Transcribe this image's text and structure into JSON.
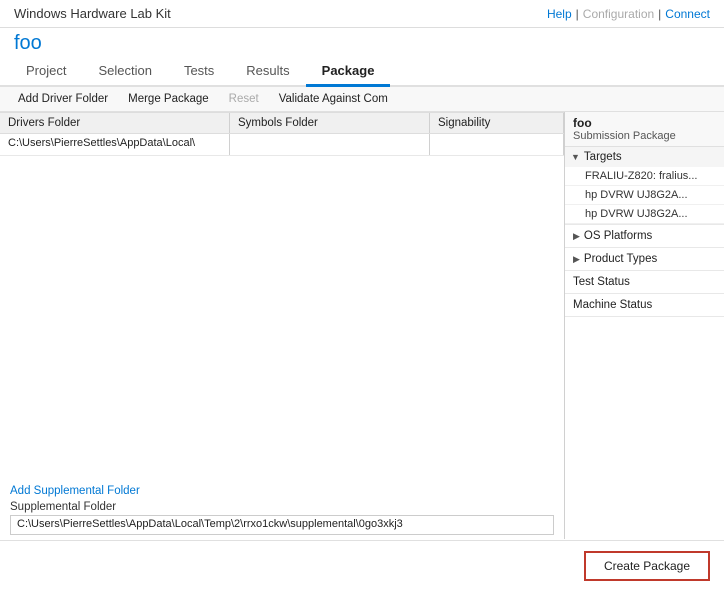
{
  "header": {
    "title": "Windows Hardware Lab Kit",
    "links": {
      "help": "Help",
      "sep1": "|",
      "config": "Configuration",
      "sep2": "|",
      "connect": "Connect"
    }
  },
  "app_name": "foo",
  "nav": {
    "tabs": [
      {
        "id": "project",
        "label": "Project",
        "active": false
      },
      {
        "id": "selection",
        "label": "Selection",
        "active": false
      },
      {
        "id": "tests",
        "label": "Tests",
        "active": false
      },
      {
        "id": "results",
        "label": "Results",
        "active": false
      },
      {
        "id": "package",
        "label": "Package",
        "active": true
      }
    ]
  },
  "toolbar": {
    "buttons": [
      {
        "id": "add-driver",
        "label": "Add Driver Folder",
        "disabled": false
      },
      {
        "id": "merge",
        "label": "Merge Package",
        "disabled": false
      },
      {
        "id": "reset",
        "label": "Reset",
        "disabled": true
      },
      {
        "id": "validate",
        "label": "Validate Against Com",
        "disabled": false
      }
    ]
  },
  "folder_table": {
    "headers": {
      "drivers": "Drivers Folder",
      "symbols": "Symbols Folder",
      "signability": "Signability"
    },
    "path": "C:\\Users\\PierreSettles\\AppData\\Local\\"
  },
  "supplemental": {
    "add_label": "Add Supplemental Folder",
    "header": "Supplemental Folder",
    "path": "C:\\Users\\PierreSettles\\AppData\\Local\\Temp\\2\\rrxo1ckw\\supplemental\\0go3xkj3"
  },
  "right_panel": {
    "pkg_name": "foo",
    "pkg_sub": "Submission Package",
    "targets_label": "Targets",
    "targets": [
      "FRALIU-Z820: fralius...",
      "hp DVRW  UJ8G2A...",
      "hp DVRW  UJ8G2A..."
    ],
    "os_platforms": "OS Platforms",
    "product_types": "Product Types",
    "test_status": "Test Status",
    "machine_status": "Machine Status"
  },
  "buttons": {
    "create_package": "Create Package"
  }
}
